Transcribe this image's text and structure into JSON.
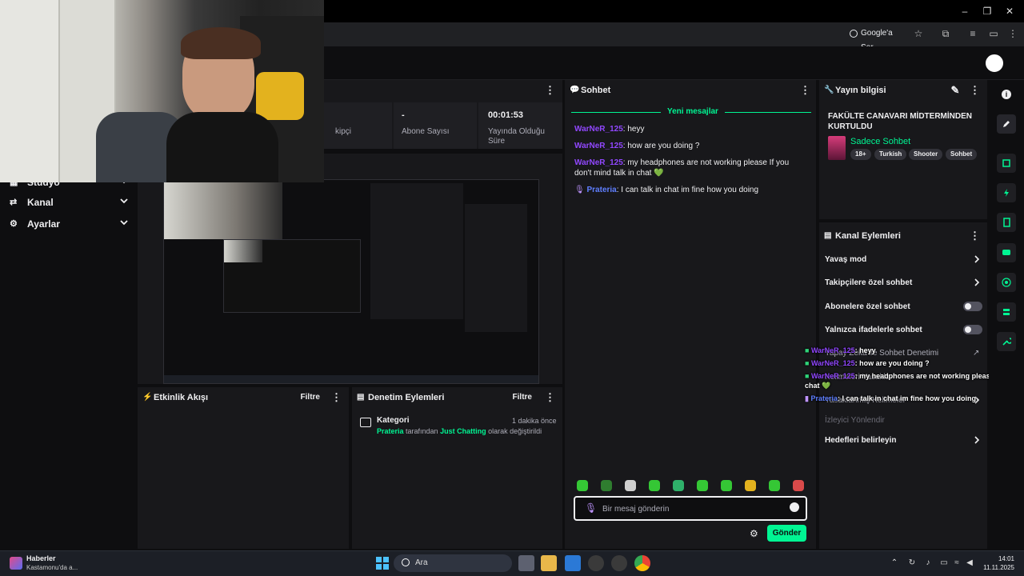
{
  "browser": {
    "google_ask": "Google'a Sor"
  },
  "nav": {
    "items": [
      {
        "label": "Stüdyo"
      },
      {
        "label": "Kanal"
      },
      {
        "label": "Ayarlar"
      }
    ]
  },
  "stats": {
    "followers_value": "",
    "followers_label": "kipçi",
    "subs_value": "-",
    "subs_label": "Abone Sayısı",
    "uptime_value": "00:01:53",
    "uptime_label": "Yayında Olduğu Süre"
  },
  "chat": {
    "title": "Sohbet",
    "new_messages": "Yeni mesajlar",
    "messages": [
      {
        "user": "WarNeR_125",
        "text": ": heyy"
      },
      {
        "user": "WarNeR_125",
        "text": ": how are you doing ?"
      },
      {
        "user": "WarNeR_125",
        "text": ": my headphones are not working please If you don't mind talk in chat 💚"
      },
      {
        "user": "Prateria",
        "text": ": I can talk in chat im fine how you doing"
      }
    ],
    "placeholder": "Bir mesaj gönderin",
    "send": "Gönder"
  },
  "stream_info": {
    "title": "Yayın bilgisi",
    "stream_title": "FAKÜLTE CANAVARI MİDTERMİNDEN KURTULDU",
    "category": "Sadece Sohbet",
    "tags": [
      "18+",
      "Turkish",
      "Shooter",
      "Sohbet"
    ]
  },
  "channel_actions": {
    "title": "Kanal Eylemleri",
    "items": [
      {
        "label": "Yavaş mod"
      },
      {
        "label": "Takipçilere özel sohbet"
      },
      {
        "label": "Abonelere özel sohbet"
      },
      {
        "label": "Yalnızca ifadelerle sohbet"
      },
      {
        "label": "Yapay Zeka ile Sohbet Denetimi"
      },
      {
        "label": "Kelimeleri Yasakla"
      },
      {
        "label": "Yasaklanmış Kelimeler"
      },
      {
        "label": "İzleyici Yönlendir"
      },
      {
        "label": "Hedefleri belirleyin"
      }
    ]
  },
  "overlay": [
    {
      "user": "WarNeR_125",
      "text": ": heyy"
    },
    {
      "user": "WarNeR_125",
      "text": ": how are you doing ?"
    },
    {
      "user": "WarNeR_125",
      "text": ": my headphones are not working please If you don't mi"
    },
    {
      "user": "",
      "text": "chat 💚"
    },
    {
      "user": "Prateria",
      "text": ": I can talk in chat im fine how you doing"
    }
  ],
  "activity": {
    "title": "Etkinlik Akışı",
    "filter": "Filtre"
  },
  "modlog": {
    "title": "Denetim Eylemleri",
    "filter": "Filtre",
    "entry_title": "Kategori",
    "entry_time": "1 dakika önce",
    "entry_user": "Prateria",
    "entry_mid": " tarafından ",
    "entry_cat": "Just Chatting",
    "entry_end": " olarak değiştirildi"
  },
  "taskbar": {
    "news_title": "Haberler",
    "news_sub": "Kastamonu'da a...",
    "search": "Ara",
    "time": "14:01",
    "date": "11.11.2025"
  },
  "colors": {
    "accent": "#00f593",
    "user_warner": "#9147ff",
    "user_prateria": "#5f7fff",
    "panel": "#18181b",
    "bg": "#0e0e10"
  }
}
